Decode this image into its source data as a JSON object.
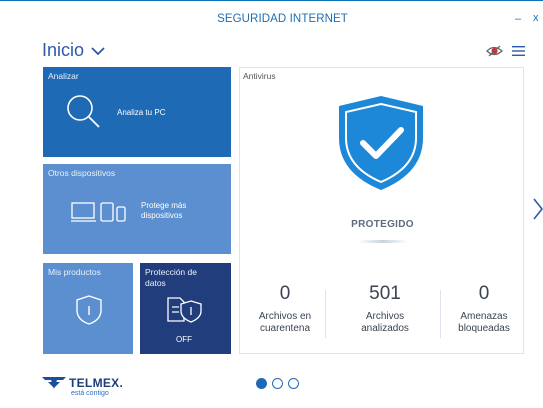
{
  "window": {
    "title": "SEGURIDAD INTERNET",
    "minimize_glyph": "–",
    "close_glyph": "x"
  },
  "header": {
    "section": "Inicio",
    "menu_icon": "hamburger-icon",
    "status_icon": "eye-toggle-icon"
  },
  "tiles": {
    "analizar": {
      "label": "Analizar",
      "action": "Analiza tu PC",
      "icon": "search-icon"
    },
    "otros": {
      "label": "Otros dispositivos",
      "action_line1": "Protege más",
      "action_line2": "dispositivos",
      "icon": "devices-icon"
    },
    "mis_productos": {
      "label": "Mis productos",
      "icon": "shield-icon"
    },
    "proteccion": {
      "label_line1": "Protección de",
      "label_line2": "datos",
      "status": "OFF",
      "icon": "data-shield-icon"
    }
  },
  "antivirus": {
    "label": "Antivirus",
    "status": "PROTEGIDO",
    "stats": [
      {
        "value": "0",
        "caption_line1": "Archivos en",
        "caption_line2": "cuarentena"
      },
      {
        "value": "501",
        "caption_line1": "Archivos",
        "caption_line2": "analizados"
      },
      {
        "value": "0",
        "caption_line1": "Amenazas",
        "caption_line2": "bloqueadas"
      }
    ]
  },
  "brand": {
    "name": "TELMEX.",
    "tagline": "está contigo"
  },
  "pagination": {
    "pages": 3,
    "current": 1
  },
  "colors": {
    "accent": "#1f6ab5",
    "tile_light": "#5b8fd0",
    "tile_dark": "#213d7c",
    "shield": "#1e88d8"
  }
}
